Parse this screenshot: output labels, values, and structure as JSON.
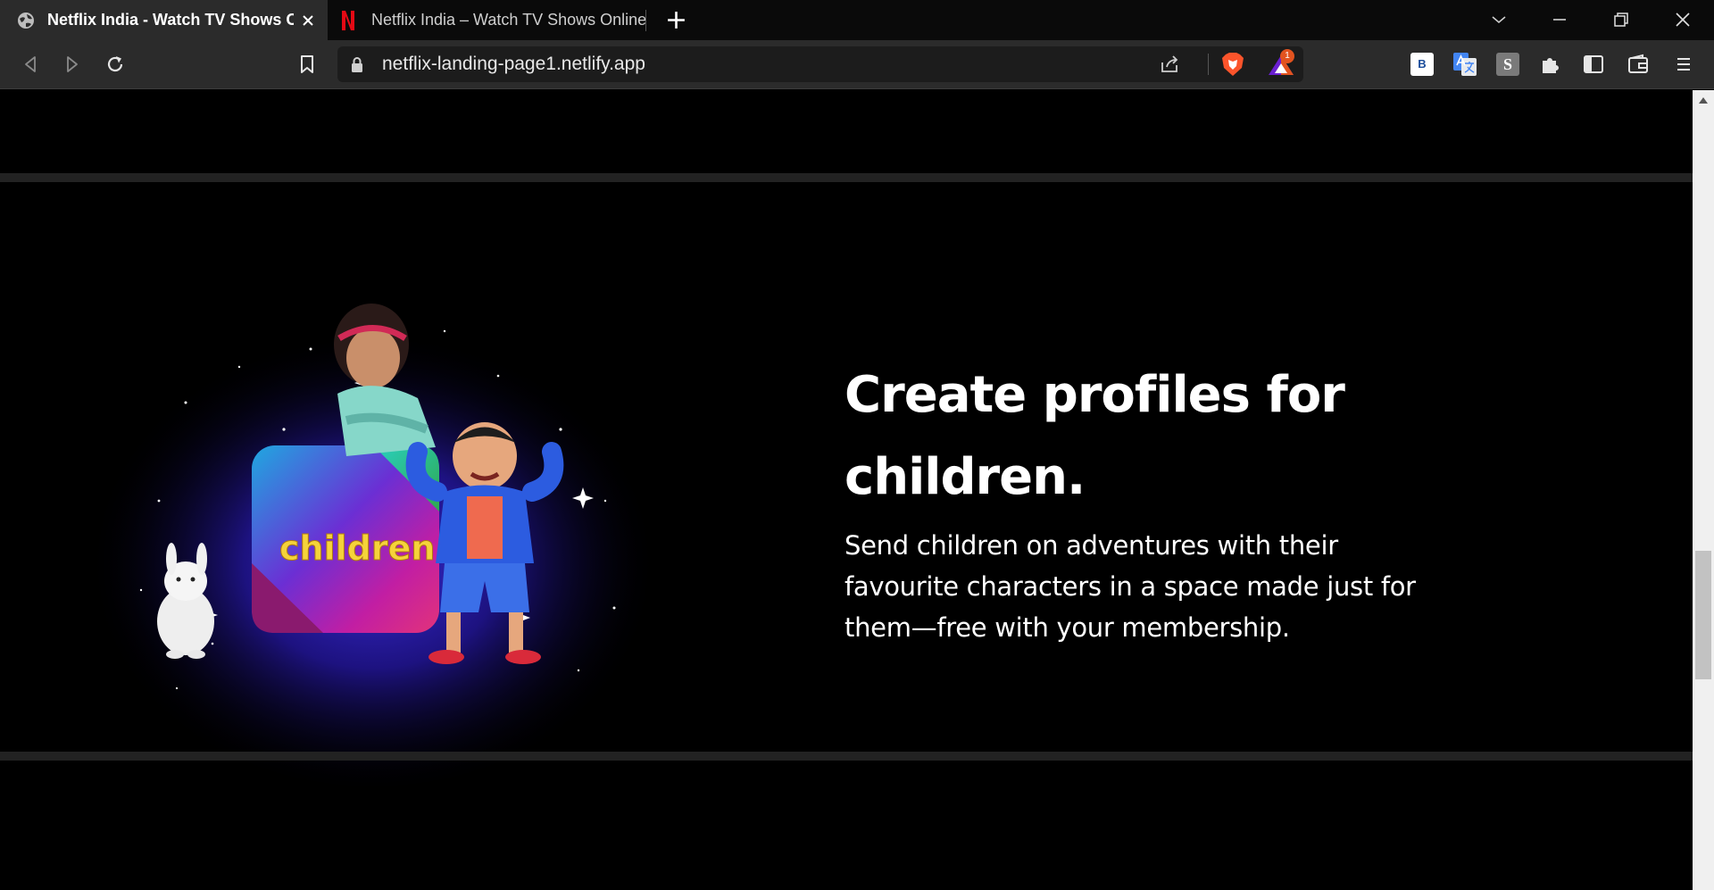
{
  "browser": {
    "tabs": [
      {
        "title": "Netflix India - Watch TV Shows Online",
        "active": true
      },
      {
        "title": "Netflix India – Watch TV Shows Online",
        "active": false
      }
    ],
    "address_bar": {
      "url": "netflix-landing-page1.netlify.app"
    },
    "rewards_badge": "1",
    "extensions": {
      "b_label": "B",
      "s_label": "S"
    }
  },
  "page": {
    "feature": {
      "image_label": "children",
      "heading_line1": "Create profiles for",
      "heading_line2": "children.",
      "text_line1": "Send children on adventures with their",
      "text_line2": "favourite characters in a space made just for",
      "text_line3": "them—free with your membership."
    }
  },
  "colors": {
    "background": "#000000",
    "divider": "#222222",
    "netflix_red": "#e50914",
    "tab_active": "#2b2b2b",
    "image_label_yellow": "#f5d33a"
  }
}
